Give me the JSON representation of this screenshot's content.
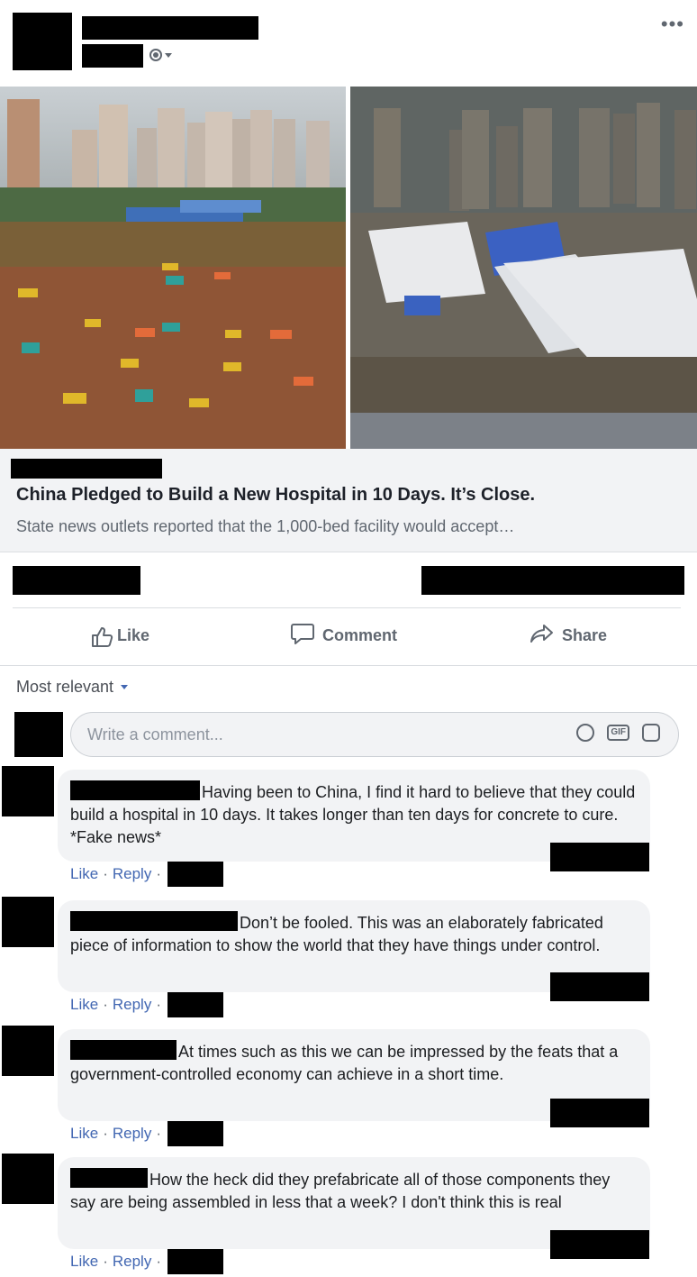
{
  "post": {
    "more_label": "•••",
    "link": {
      "title": "China Pledged to Build a New Hospital in 10 Days. It’s Close.",
      "description": "State news outlets reported that the 1,000-bed facility would accept…"
    }
  },
  "actions": {
    "like": "Like",
    "comment": "Comment",
    "share": "Share"
  },
  "comments_section": {
    "sort_label": "Most relevant",
    "input_placeholder": "Write a comment...",
    "gif_label": "GIF"
  },
  "comments": [
    {
      "text": "Having been to China, I find it hard to believe that they could build a hospital in 10 days. It takes longer than ten days for concrete to cure. *Fake news*",
      "like": "Like",
      "reply": "Reply"
    },
    {
      "text": "Don’t be fooled. This was an elaborately fabricated piece of information to show the world that they have things under control.",
      "like": "Like",
      "reply": "Reply"
    },
    {
      "text": "At times such as this we can be impressed by the feats that a government-controlled economy can achieve in a short time.",
      "like": "Like",
      "reply": "Reply"
    },
    {
      "text": "How the heck did they prefabricate all of those components they say are being assembled in less that a week? I don't think this is real",
      "like": "Like",
      "reply": "Reply"
    }
  ]
}
